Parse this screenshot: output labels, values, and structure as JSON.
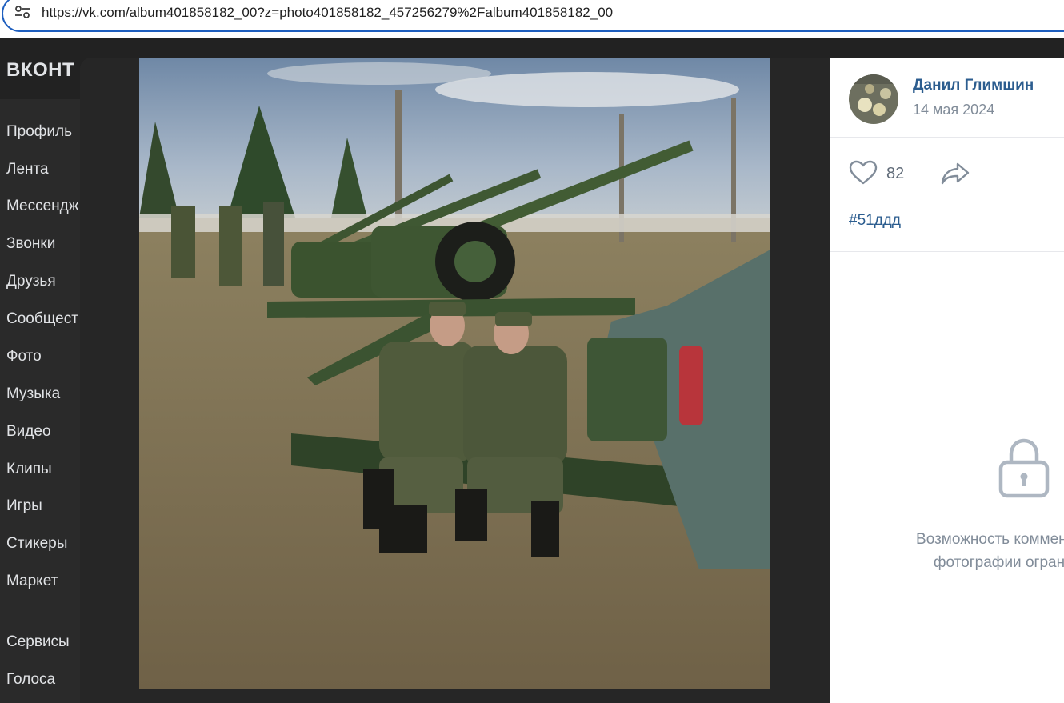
{
  "browser": {
    "url": "https://vk.com/album401858182_00?z=photo401858182_457256279%2Falbum401858182_00",
    "site_info_icon": "tune-icon"
  },
  "vk": {
    "logo": "ВКОНТ",
    "nav": [
      {
        "label": "Профиль"
      },
      {
        "label": "Лента"
      },
      {
        "label": "Мессендж"
      },
      {
        "label": "Звонки"
      },
      {
        "label": "Друзья"
      },
      {
        "label": "Сообщест"
      },
      {
        "label": "Фото"
      },
      {
        "label": "Музыка"
      },
      {
        "label": "Видео"
      },
      {
        "label": "Клипы"
      },
      {
        "label": "Игры"
      },
      {
        "label": "Стикеры"
      },
      {
        "label": "Маркет"
      },
      {
        "label": "Сервисы"
      },
      {
        "label": "Голоса"
      }
    ]
  },
  "viewer": {
    "author_name": "Данил Глимшин",
    "date": "14 мая 2024",
    "likes": "82",
    "hashtag": "#51ддд",
    "comments_disabled_line1": "Возможность комменти",
    "comments_disabled_line2": "фотографии огран",
    "colors": {
      "link": "#2c5d8f",
      "muted": "#818c99",
      "icon": "#aeb7c2"
    }
  }
}
